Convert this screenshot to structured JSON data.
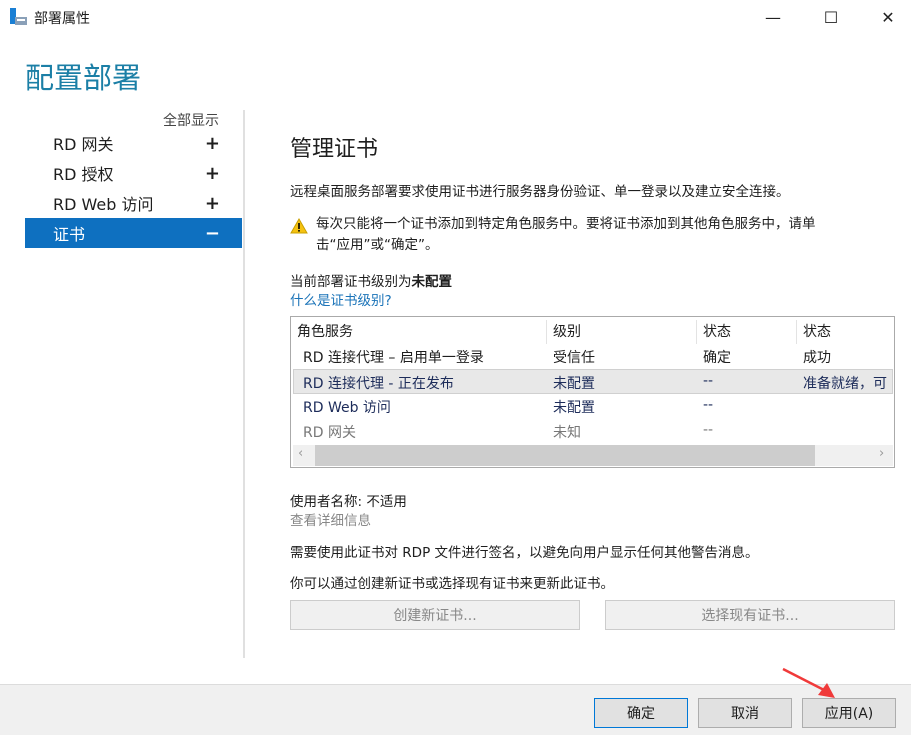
{
  "window": {
    "title": "部署属性",
    "minimize": "—",
    "maximize": "☐",
    "close": "✕"
  },
  "page_title": "配置部署",
  "nav": {
    "show_all": "全部显示",
    "items": [
      {
        "label": "RD 网关",
        "toggle": "+"
      },
      {
        "label": "RD 授权",
        "toggle": "+"
      },
      {
        "label": "RD Web 访问",
        "toggle": "+"
      },
      {
        "label": "证书",
        "toggle": "−"
      }
    ]
  },
  "main": {
    "heading": "管理证书",
    "intro": "远程桌面服务部署要求使用证书进行服务器身份验证、单一登录以及建立安全连接。",
    "warning_line1": "每次只能将一个证书添加到特定角色服务中。要将证书添加到其他角色服务中，请单",
    "warning_line2": "击“应用”或“确定”。",
    "level_prefix": "当前部署证书级别为",
    "level_value": "未配置",
    "level_link": "什么是证书级别?",
    "table": {
      "headers": [
        "角色服务",
        "级别",
        "状态",
        "状态"
      ],
      "rows": [
        [
          "RD 连接代理 – 启用单一登录",
          "受信任",
          "确定",
          "成功"
        ],
        [
          "RD 连接代理 - 正在发布",
          "未配置",
          "--",
          "准备就绪，可"
        ],
        [
          "RD Web 访问",
          "未配置",
          "--",
          ""
        ],
        [
          "RD 网关",
          "未知",
          "--",
          ""
        ]
      ]
    },
    "subject": "使用者名称: 不适用",
    "details_link": "查看详细信息",
    "rdp_note": "需要使用此证书对 RDP 文件进行签名，以避免向用户显示任何其他警告消息。",
    "update_note": "你可以通过创建新证书或选择现有证书来更新此证书。",
    "create_btn": "创建新证书...",
    "select_btn": "选择现有证书..."
  },
  "footer": {
    "ok": "确定",
    "cancel": "取消",
    "apply": "应用(A)"
  }
}
